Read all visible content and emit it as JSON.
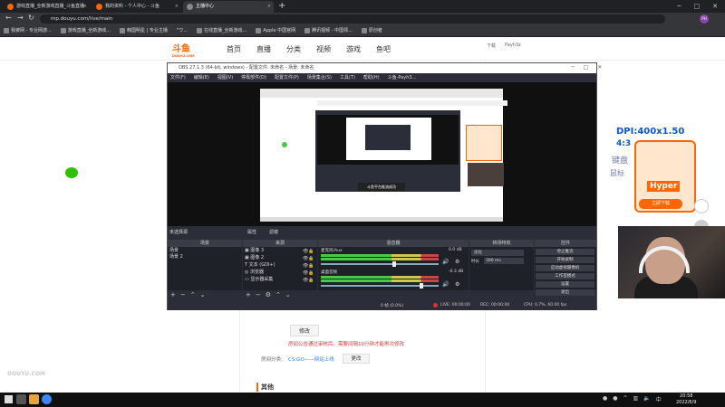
{
  "browser": {
    "tabs": [
      {
        "label": "游戏直播_全新游戏直播_斗鱼直播",
        "active": false,
        "color": "#f60"
      },
      {
        "label": "我的资料 - 个人中心 - 斗鱼",
        "active": false,
        "color": "#f60"
      },
      {
        "label": "主播中心",
        "active": true,
        "color": "#888"
      }
    ],
    "url": "mp.douyu.com/live/main",
    "bookmarks": [
      "我被网 - 专业网游...",
      "游戏直播_全新游戏...",
      "韩国明星 | 专业主播",
      "\"ワ...",
      "在线直播_全新游戏...",
      "Apple 中国官网",
      "腾讯视频 - 中国领...",
      "原创者"
    ],
    "profile_initial": "PH"
  },
  "site": {
    "logo": "斗鱼",
    "logo_sub": "DOUYU.COM",
    "nav": [
      "首页",
      "直播",
      "分类",
      "视频",
      "游戏",
      "鱼吧"
    ],
    "download_label": "下载",
    "username": "Payh3z"
  },
  "obs": {
    "title": "OBS 27.1.3 (64-bit, windows) - 配置文件: 未命名 - 场景: 未命名",
    "menu": [
      "文件(F)",
      "编辑(E)",
      "视图(V)",
      "停靠部件(D)",
      "配置文件(P)",
      "场景集合(S)",
      "工具(T)",
      "帮助(H)",
      "斗鱼-Payh3..."
    ],
    "source_status": "未选择源",
    "properties_btn": "属性",
    "filters_btn": "滤镜",
    "docks": {
      "scenes": {
        "title": "场景",
        "items": [
          "场景",
          "场景 2"
        ]
      },
      "sources": {
        "title": "来源",
        "items": [
          "图像 3",
          "图像 2",
          "文本 (GDI+)",
          "浏览器",
          "显示器采集"
        ]
      },
      "mixer": {
        "title": "混音器",
        "channels": [
          {
            "name": "麦克风/Aux",
            "db": "0.0 dB",
            "level": 0.62
          },
          {
            "name": "桌面音频",
            "db": "-0.3 dB",
            "level": 0.85
          }
        ]
      },
      "transitions": {
        "title": "转场特效",
        "selected": "淡化",
        "duration_label": "时长",
        "duration": "300 ms"
      },
      "controls": {
        "title": "控件",
        "buttons": [
          "停止推流",
          "开始录制",
          "启动虚拟摄像机",
          "工作室模式",
          "设置",
          "退出"
        ]
      }
    },
    "status": {
      "dropped": "0 帧 (0.0%)",
      "live": "LIVE: 00:00:00",
      "rec": "REC: 00:00:00",
      "cpu": "CPU: 0.7%, 60.00 fps"
    },
    "nested_toast": "斗鱼平台推流成功"
  },
  "page": {
    "edit_btn": "修改",
    "notice": "房间公告通过审核后，需要间隔10分钟才能再次修改",
    "category_label": "房间分类:",
    "category_link": "CS:GO——网站上线",
    "category_btn": "更改",
    "other_title": "其他"
  },
  "ad": {
    "dpi": "DPI:400x1.50",
    "line1": "4:3",
    "line2": "键盘",
    "line3": "鼠标",
    "brand": "Hyper",
    "button": "立即下载"
  },
  "watermark": "DOUYU.COM",
  "taskbar": {
    "time": "20:58",
    "date": "2022/6/9"
  }
}
